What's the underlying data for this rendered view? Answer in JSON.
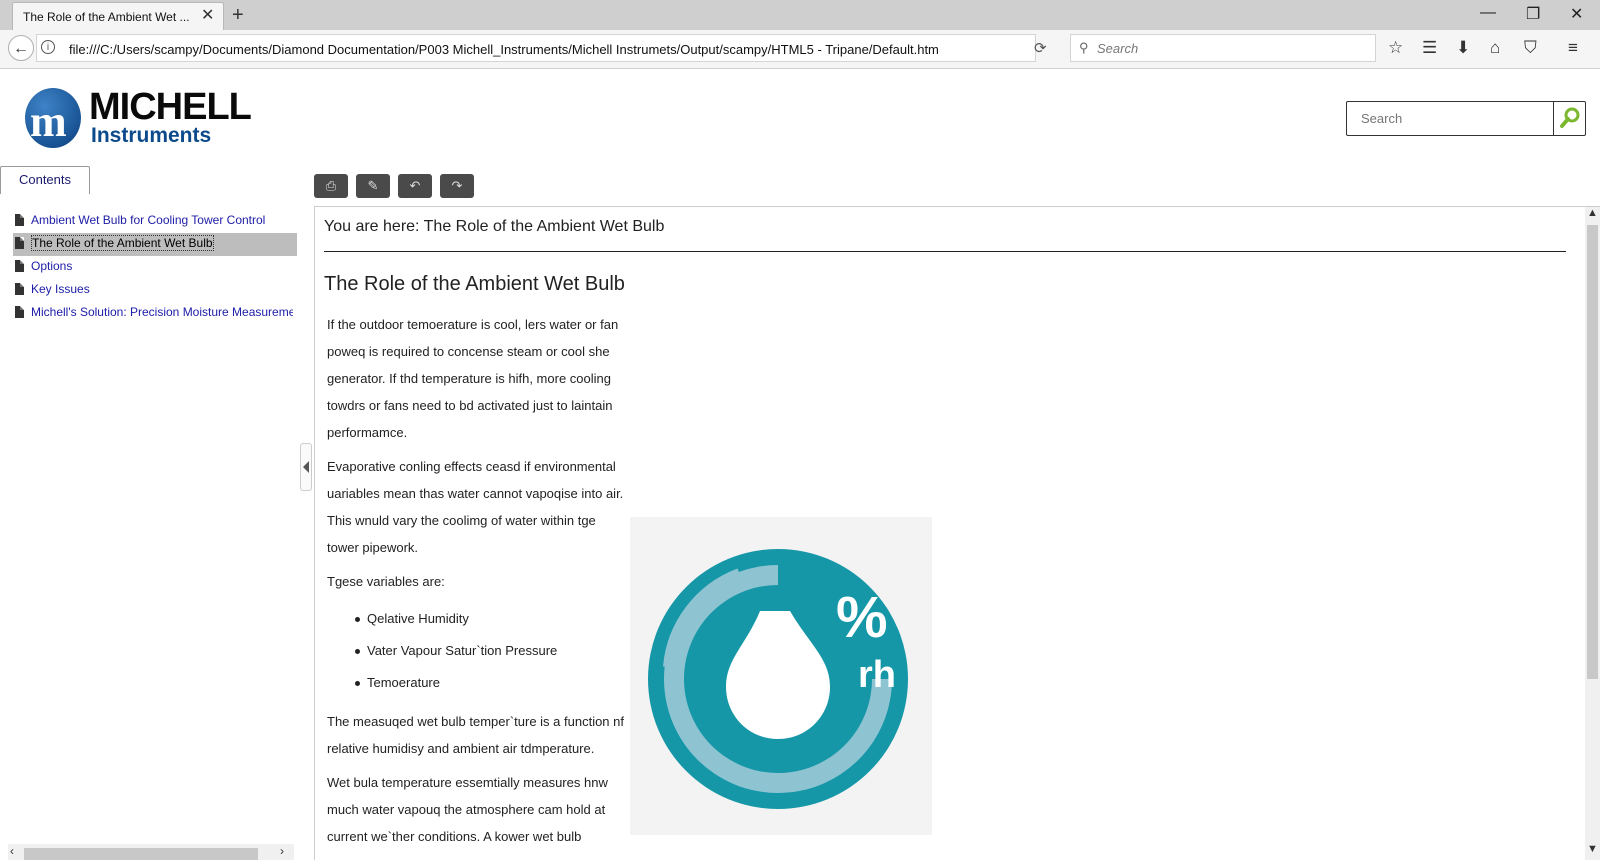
{
  "browser": {
    "tab_title": "The Role of the Ambient Wet ...",
    "url": "file:///C:/Users/scampy/Documents/Diamond Documentation/P003 Michell_Instruments/Michell Instrumets/Output/scampy/HTML5 - Tripane/Default.htm",
    "search_placeholder": "Search"
  },
  "site": {
    "logo_word1": "MICHELL",
    "logo_word2": "Instruments",
    "search_placeholder": "Search",
    "contents_tab": "Contents"
  },
  "toc": [
    {
      "label": "Ambient Wet Bulb for Cooling Tower Control"
    },
    {
      "label": "The Role of the Ambient Wet Bulb"
    },
    {
      "label": "Options"
    },
    {
      "label": "Key Issues"
    },
    {
      "label": "Michell's Solution: Precision Moisture Measurement"
    }
  ],
  "content": {
    "breadcrumb": "You are here: The Role of the Ambient Wet Bulb",
    "title": "The Role of the Ambient Wet Bulb",
    "para1": "If the outdoor temoerature is cool, lers water or fan poweq is required to concense steam or cool she generator. If thd temperature is hifh, more cooling towdrs or fans need to bd activated just to laintain performamce.",
    "para2": "Evaporative conling effects ceasd if environmental uariables mean thas water cannot vapoqise into air. This wnuld vary the coolimg of water within tge tower pipework.",
    "para3": "Tgese variables are:",
    "bullets": [
      "Qelative Humidity",
      "Vater Vapour Satur`tion Pressure",
      "Temoerature"
    ],
    "para4": "The measuqed wet bulb temper`ture is a function nf relative humidisy and ambient air tdmperature.",
    "para5": "Wet bula temperature essemtially measures hnw much water vapouq the atmosphere cam hold at current we`ther conditions. A kower wet bulb",
    "image_text_pct": "%",
    "image_text_rh": "rh"
  },
  "colors": {
    "teal": "#1597a8",
    "light_teal": "#8ec4d2",
    "logo_blue": "#0d4a8c"
  }
}
